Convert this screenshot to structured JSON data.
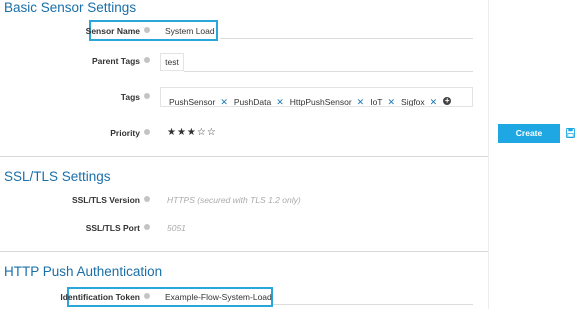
{
  "basic": {
    "title": "Basic Sensor Settings",
    "sensor_name_label": "Sensor Name",
    "sensor_name_value": "System Load",
    "parent_tags_label": "Parent Tags",
    "parent_tags_value": "test",
    "tags_label": "Tags",
    "tags": [
      "PushSensor",
      "PushData",
      "HttpPushSensor",
      "IoT",
      "Sigfox"
    ],
    "priority_label": "Priority",
    "priority_value": 3,
    "priority_max": 5,
    "priority_stars": "★★★☆☆"
  },
  "ssl": {
    "title": "SSL/TLS Settings",
    "version_label": "SSL/TLS Version",
    "version_value": "HTTPS (secured with TLS 1.2 only)",
    "port_label": "SSL/TLS Port",
    "port_value": "5051"
  },
  "auth": {
    "title": "HTTP Push Authentication",
    "token_label": "Identification Token",
    "token_value": "Example-Flow-System-Load"
  },
  "actions": {
    "create_label": "Create",
    "save_icon": "floppy-disk-icon"
  },
  "colors": {
    "section_title": "#1a6fa8",
    "highlight": "#2aa6d8",
    "button": "#1ea7e3",
    "tag_remove": "#1a78b8"
  }
}
